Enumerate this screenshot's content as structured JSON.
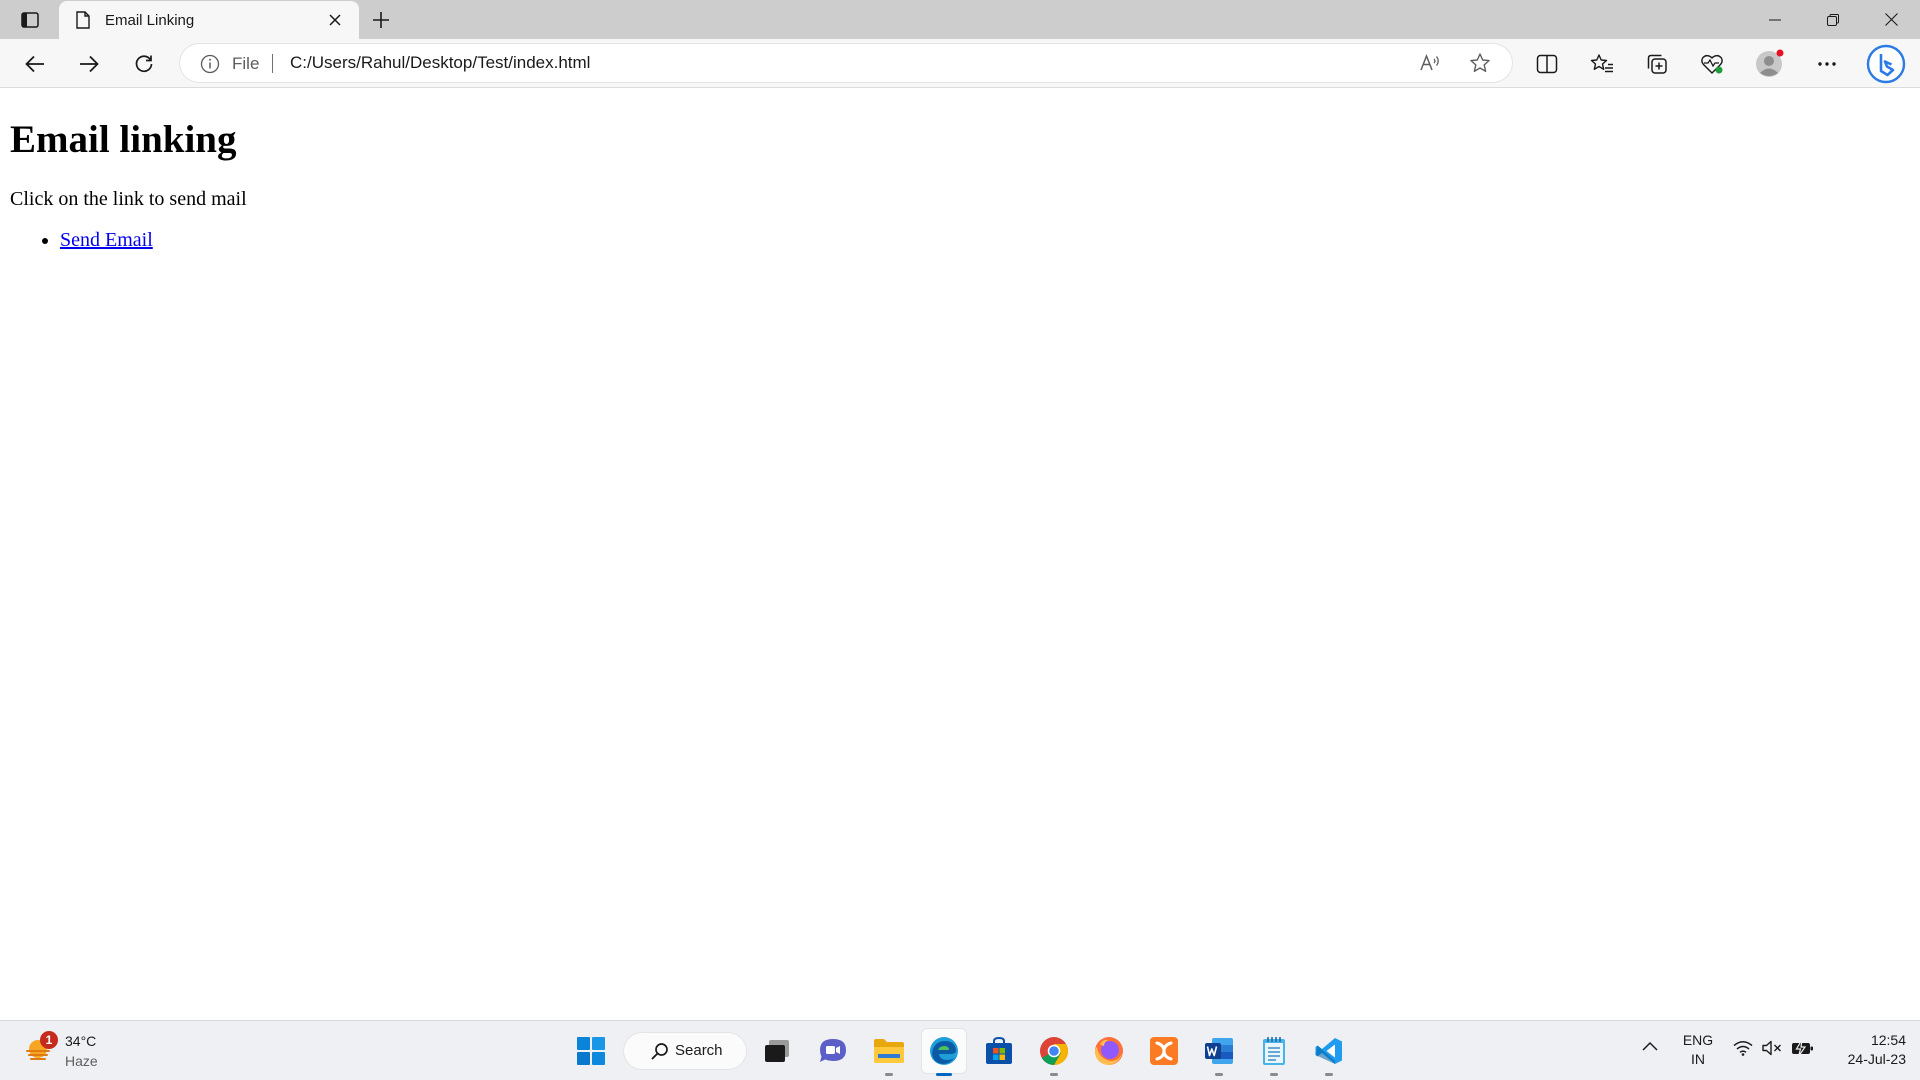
{
  "browser": {
    "tab": {
      "title": "Email Linking"
    },
    "address": {
      "scheme_label": "File",
      "url": "C:/Users/Rahul/Desktop/Test/index.html"
    }
  },
  "page": {
    "heading": "Email linking",
    "paragraph": "Click on the link to send mail",
    "links": [
      {
        "label": "Send Email"
      }
    ]
  },
  "taskbar": {
    "weather": {
      "badge": "1",
      "temperature": "34°C",
      "condition": "Haze"
    },
    "search_label": "Search",
    "language": {
      "line1": "ENG",
      "line2": "IN"
    },
    "clock": {
      "time": "12:54",
      "date": "24-Jul-23"
    }
  },
  "colors": {
    "link": "#0000ee",
    "tabstrip": "#cdcdcd",
    "toolbar": "#f7f7f7",
    "taskbar": "#eef0f3",
    "accent": "#0067c0"
  }
}
